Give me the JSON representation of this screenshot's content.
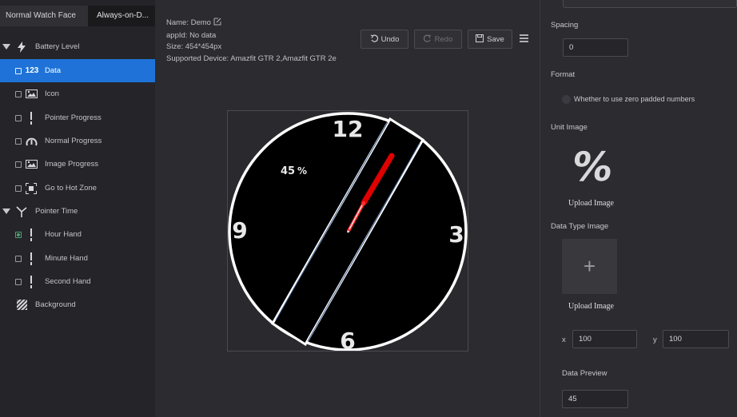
{
  "tabs": [
    {
      "label": "Normal Watch Face"
    },
    {
      "label": "Always-on-D..."
    }
  ],
  "tree": {
    "battery_group": "Battery Level",
    "data_icon_text": "123",
    "items": [
      {
        "label": "Data",
        "icon": "123-icon",
        "selected": true
      },
      {
        "label": "Icon",
        "icon": "image-icon"
      },
      {
        "label": "Pointer Progress",
        "icon": "pointer-icon"
      },
      {
        "label": "Normal Progress",
        "icon": "gauge-icon"
      },
      {
        "label": "Image Progress",
        "icon": "image-icon"
      },
      {
        "label": "Go to Hot Zone",
        "icon": "hotzone-icon"
      }
    ],
    "pointer_group": "Pointer Time",
    "pointer_items": [
      {
        "label": "Hour Hand",
        "checked": true
      },
      {
        "label": "Minute Hand"
      },
      {
        "label": "Second Hand"
      }
    ],
    "background": "Background"
  },
  "info": {
    "name_label": "Name:",
    "name_value": "Demo",
    "appid_label": "appId:",
    "appid_value": "No data",
    "size_label": "Size:",
    "size_value": "454*454px",
    "device_label": "Supported Device:",
    "device_value": "Amazfit GTR 2,Amazfit GTR 2e"
  },
  "toolbar": {
    "undo": "Undo",
    "redo": "Redo",
    "save": "Save"
  },
  "watch": {
    "n12": "12",
    "n3": "3",
    "n6": "6",
    "n9": "9",
    "battery_text": "45",
    "battery_unit": "%"
  },
  "props": {
    "spacing_label": "Spacing",
    "spacing_value": "0",
    "format_label": "Format",
    "format_option": "Whether to use zero padded numbers",
    "unit_image_label": "Unit Image",
    "unit_image_glyph": "%",
    "upload_1": "Upload Image",
    "data_type_label": "Data Type Image",
    "plus": "+",
    "upload_2": "Upload Image",
    "x_label": "x",
    "x_value": "100",
    "y_label": "y",
    "y_value": "100",
    "preview_label": "Data Preview",
    "preview_value": "45"
  },
  "colors": {
    "accent": "#1f73d8",
    "hand_red": "#e00000",
    "panel": "#252529"
  }
}
